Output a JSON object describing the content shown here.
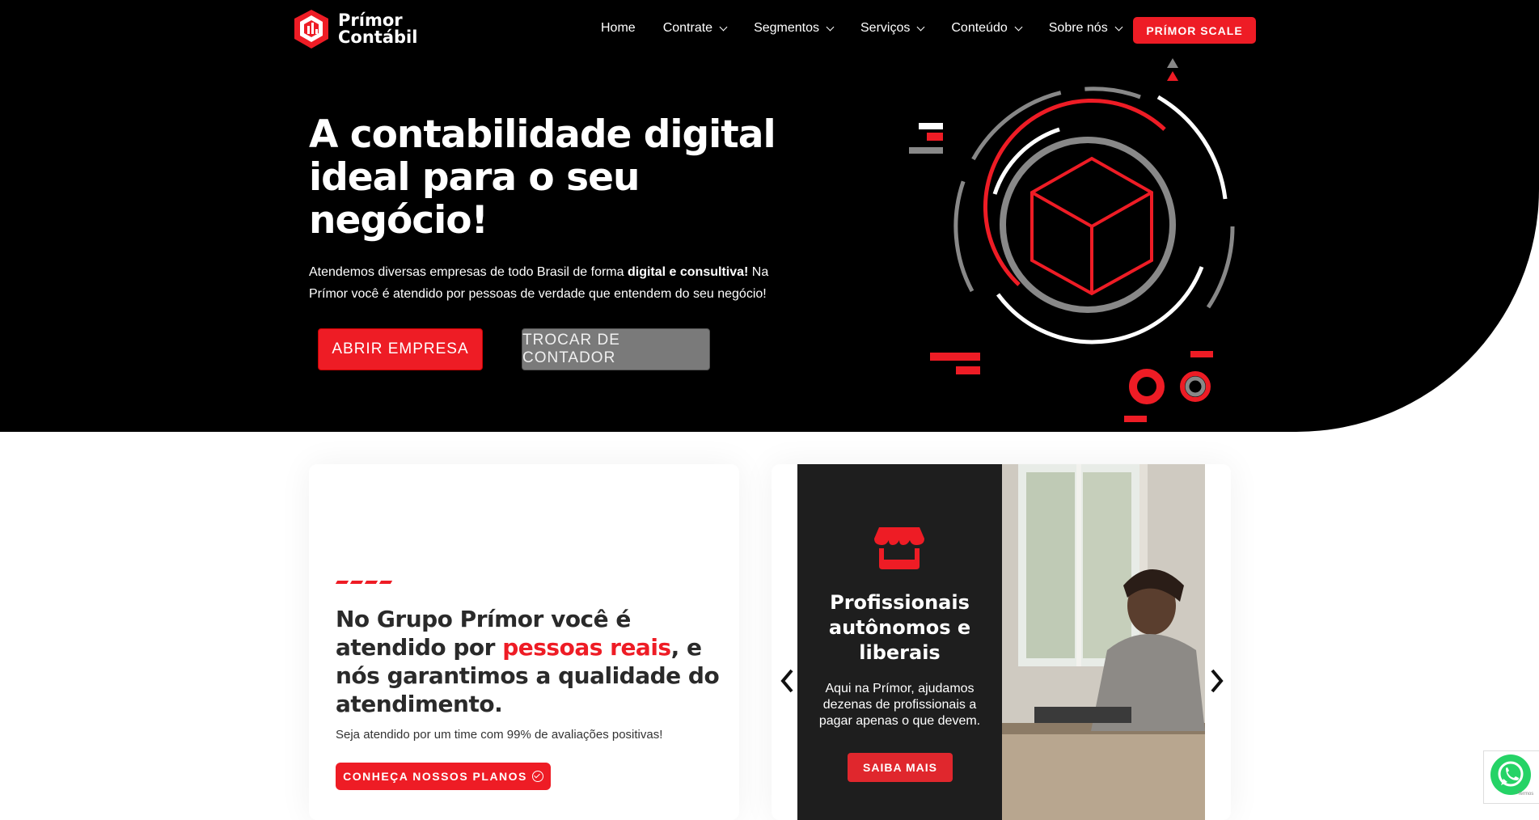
{
  "brand": {
    "name_line1": "Prímor",
    "name_line2": "Contábil",
    "accent_color": "#ee1c25",
    "dark_color": "#000000"
  },
  "nav": {
    "items": [
      {
        "label": "Home",
        "has_dropdown": false
      },
      {
        "label": "Contrate",
        "has_dropdown": true
      },
      {
        "label": "Segmentos",
        "has_dropdown": true
      },
      {
        "label": "Serviços",
        "has_dropdown": true
      },
      {
        "label": "Conteúdo",
        "has_dropdown": true
      },
      {
        "label": "Sobre nós",
        "has_dropdown": true
      }
    ],
    "cta_label": "PRÍMOR SCALE"
  },
  "hero": {
    "title": "A contabilidade digital ideal para o seu negócio!",
    "desc_part1": "Atendemos diversas empresas de todo Brasil de forma ",
    "desc_bold": "digital e consultiva!",
    "desc_part2": " Na Prímor você é atendido por pessoas de verdade que entendem do seu negócio!",
    "btn_open": "ABRIR EMPRESA",
    "btn_change": "TROCAR DE CONTADOR",
    "art_icon": "cube-target-icon"
  },
  "about": {
    "title_part1": "No Grupo Prímor você é atendido por ",
    "title_highlight": "pessoas reais",
    "title_part2": ", e nós garantimos a qualidade do atendimento.",
    "subtitle": "Seja atendido por um time com 99% de avaliações positivas!",
    "button": "CONHEÇA NOSSOS PLANOS"
  },
  "carousel": {
    "slide_icon": "storefront-icon",
    "heading": "Profissionais autônomos e liberais",
    "text": "Aqui na Prímor, ajudamos dezenas de profissionais a pagar apenas o que devem.",
    "button": "SAIBA MAIS"
  },
  "whatsapp": {
    "icon": "whatsapp-icon",
    "mini_text": "- Termos"
  }
}
